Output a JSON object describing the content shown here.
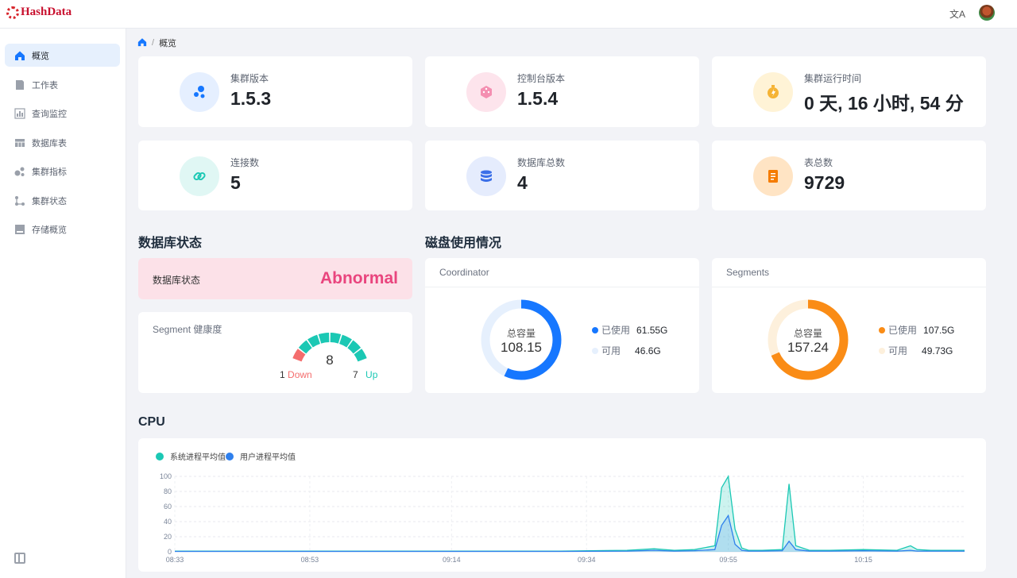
{
  "header": {
    "logo_text": "HashData",
    "language_icon": "translate-icon",
    "avatar_icon": "user-avatar"
  },
  "sidebar": {
    "items": [
      {
        "label": "概览",
        "icon": "home-icon",
        "active": true
      },
      {
        "label": "工作表",
        "icon": "worksheet-icon"
      },
      {
        "label": "查询监控",
        "icon": "bar-chart-icon"
      },
      {
        "label": "数据库表",
        "icon": "table-icon"
      },
      {
        "label": "集群指标",
        "icon": "cluster-metrics-icon"
      },
      {
        "label": "集群状态",
        "icon": "cluster-status-icon"
      },
      {
        "label": "存储概览",
        "icon": "storage-icon"
      }
    ],
    "collapse_icon": "collapse-sidebar-icon"
  },
  "breadcrumb": {
    "home_icon": "home-icon",
    "separator": "/",
    "current": "概览"
  },
  "stats": [
    {
      "label": "集群版本",
      "value": "1.5.3",
      "icon": "bubbles-icon",
      "bg": "#e5efff",
      "fg": "#1677ff"
    },
    {
      "label": "控制台版本",
      "value": "1.5.4",
      "icon": "dice-icon",
      "bg": "#fde4ec",
      "fg": "#f06292"
    },
    {
      "label": "集群运行时间",
      "value": "0 天, 16 小时, 54 分",
      "icon": "stopwatch-icon",
      "bg": "#fff3d6",
      "fg": "#f5a623"
    },
    {
      "label": "连接数",
      "value": "5",
      "icon": "link-icon",
      "bg": "#e0f7f4",
      "fg": "#1bc8b4"
    },
    {
      "label": "数据库总数",
      "value": "4",
      "icon": "database-icon",
      "bg": "#e5ecfd",
      "fg": "#3b6fe8"
    },
    {
      "label": "表总数",
      "value": "9729",
      "icon": "document-icon",
      "bg": "#ffe4c4",
      "fg": "#f57c00"
    }
  ],
  "db_status": {
    "section_title": "数据库状态",
    "label": "数据库状态",
    "value": "Abnormal",
    "value_color": "#e9457e"
  },
  "segment_health": {
    "title": "Segment 健康度",
    "total": "8",
    "down_count": "1",
    "down_label": "Down",
    "up_count": "7",
    "up_label": "Up",
    "up_color": "#1bc8b4",
    "down_color": "#f46d6d"
  },
  "disk": {
    "section_title": "磁盘使用情况",
    "cards": [
      {
        "title": "Coordinator",
        "center_label": "总容量",
        "center_value": "108.15",
        "used_label": "已使用",
        "used_value": "61.55G",
        "free_label": "可用",
        "free_value": "46.6G",
        "used_fraction": 0.569,
        "used_color": "#1677ff",
        "free_color": "#e6f0fd"
      },
      {
        "title": "Segments",
        "center_label": "总容量",
        "center_value": "157.24",
        "used_label": "已使用",
        "used_value": "107.5G",
        "free_label": "可用",
        "free_value": "49.73G",
        "used_fraction": 0.684,
        "used_color": "#fa8c16",
        "free_color": "#fdf0dc"
      }
    ]
  },
  "cpu": {
    "section_title": "CPU"
  },
  "chart_data": {
    "type": "area",
    "xlabel": "",
    "ylabel": "",
    "ylim": [
      0,
      100
    ],
    "yticks": [
      0,
      20,
      40,
      60,
      80,
      100
    ],
    "x_tick_labels": [
      "08:33",
      "08:53",
      "09:14",
      "09:34",
      "09:55",
      "10:15"
    ],
    "grid": true,
    "legend_position": "top-left",
    "series": [
      {
        "name": "系统进程平均值",
        "color": "#1bc8b4",
        "x": [
          "08:33",
          "09:00",
          "09:30",
          "09:40",
          "09:44",
          "09:47",
          "09:50",
          "09:53",
          "09:54",
          "09:55",
          "09:56",
          "09:57",
          "09:58",
          "10:00",
          "10:03",
          "10:04",
          "10:05",
          "10:07",
          "10:10",
          "10:15",
          "10:20",
          "10:22",
          "10:23",
          "10:25",
          "10:30"
        ],
        "values": [
          1,
          1,
          1,
          2,
          4,
          2,
          3,
          8,
          85,
          100,
          30,
          5,
          2,
          2,
          3,
          90,
          8,
          2,
          2,
          3,
          2,
          8,
          3,
          2,
          2
        ]
      },
      {
        "name": "用户进程平均值",
        "color": "#2f80ed",
        "x": [
          "08:33",
          "09:00",
          "09:30",
          "09:40",
          "09:44",
          "09:47",
          "09:50",
          "09:53",
          "09:54",
          "09:55",
          "09:56",
          "09:57",
          "09:58",
          "10:00",
          "10:03",
          "10:04",
          "10:05",
          "10:07",
          "10:10",
          "10:15",
          "10:20",
          "10:22",
          "10:23",
          "10:25",
          "10:30"
        ],
        "values": [
          0.5,
          0.5,
          0.5,
          1,
          2,
          1,
          1.5,
          3,
          35,
          48,
          10,
          2,
          1,
          1,
          1.5,
          14,
          3,
          1,
          1,
          1.5,
          1,
          2,
          1,
          1,
          1
        ]
      }
    ]
  }
}
